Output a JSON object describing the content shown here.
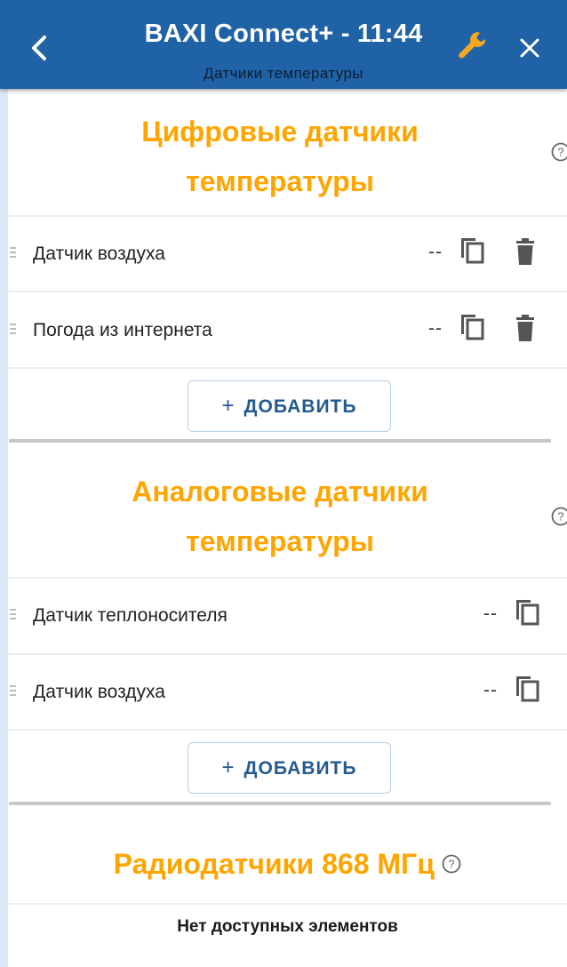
{
  "header": {
    "title": "BAXI Connect+ - 11:44",
    "subtitle": "Датчики температуры"
  },
  "digital": {
    "title_line1": "Цифровые датчики",
    "title_line2": "температуры",
    "items": [
      {
        "label": "Датчик воздуха",
        "value": "--"
      },
      {
        "label": "Погода из интернета",
        "value": "--"
      }
    ],
    "add_label": "ДОБАВИТЬ"
  },
  "analog": {
    "title_line1": "Аналоговые датчики",
    "title_line2": "температуры",
    "items": [
      {
        "label": "Датчик теплоносителя",
        "value": "--"
      },
      {
        "label": "Датчик воздуха",
        "value": "--"
      }
    ],
    "add_label": "ДОБАВИТЬ"
  },
  "radio": {
    "title": "Радиодатчики 868 МГц",
    "empty_message": "Нет доступных элементов"
  },
  "icons": {
    "back": "chevron-left-icon",
    "settings": "wrench-icon",
    "close": "close-icon",
    "help": "help-circle-icon",
    "copy": "copy-icon",
    "delete": "trash-icon",
    "drag": "drag-handle-icon"
  },
  "colors": {
    "header_bg": "#2062a6",
    "accent_orange": "#ffa500",
    "wrench": "#f5a623"
  }
}
